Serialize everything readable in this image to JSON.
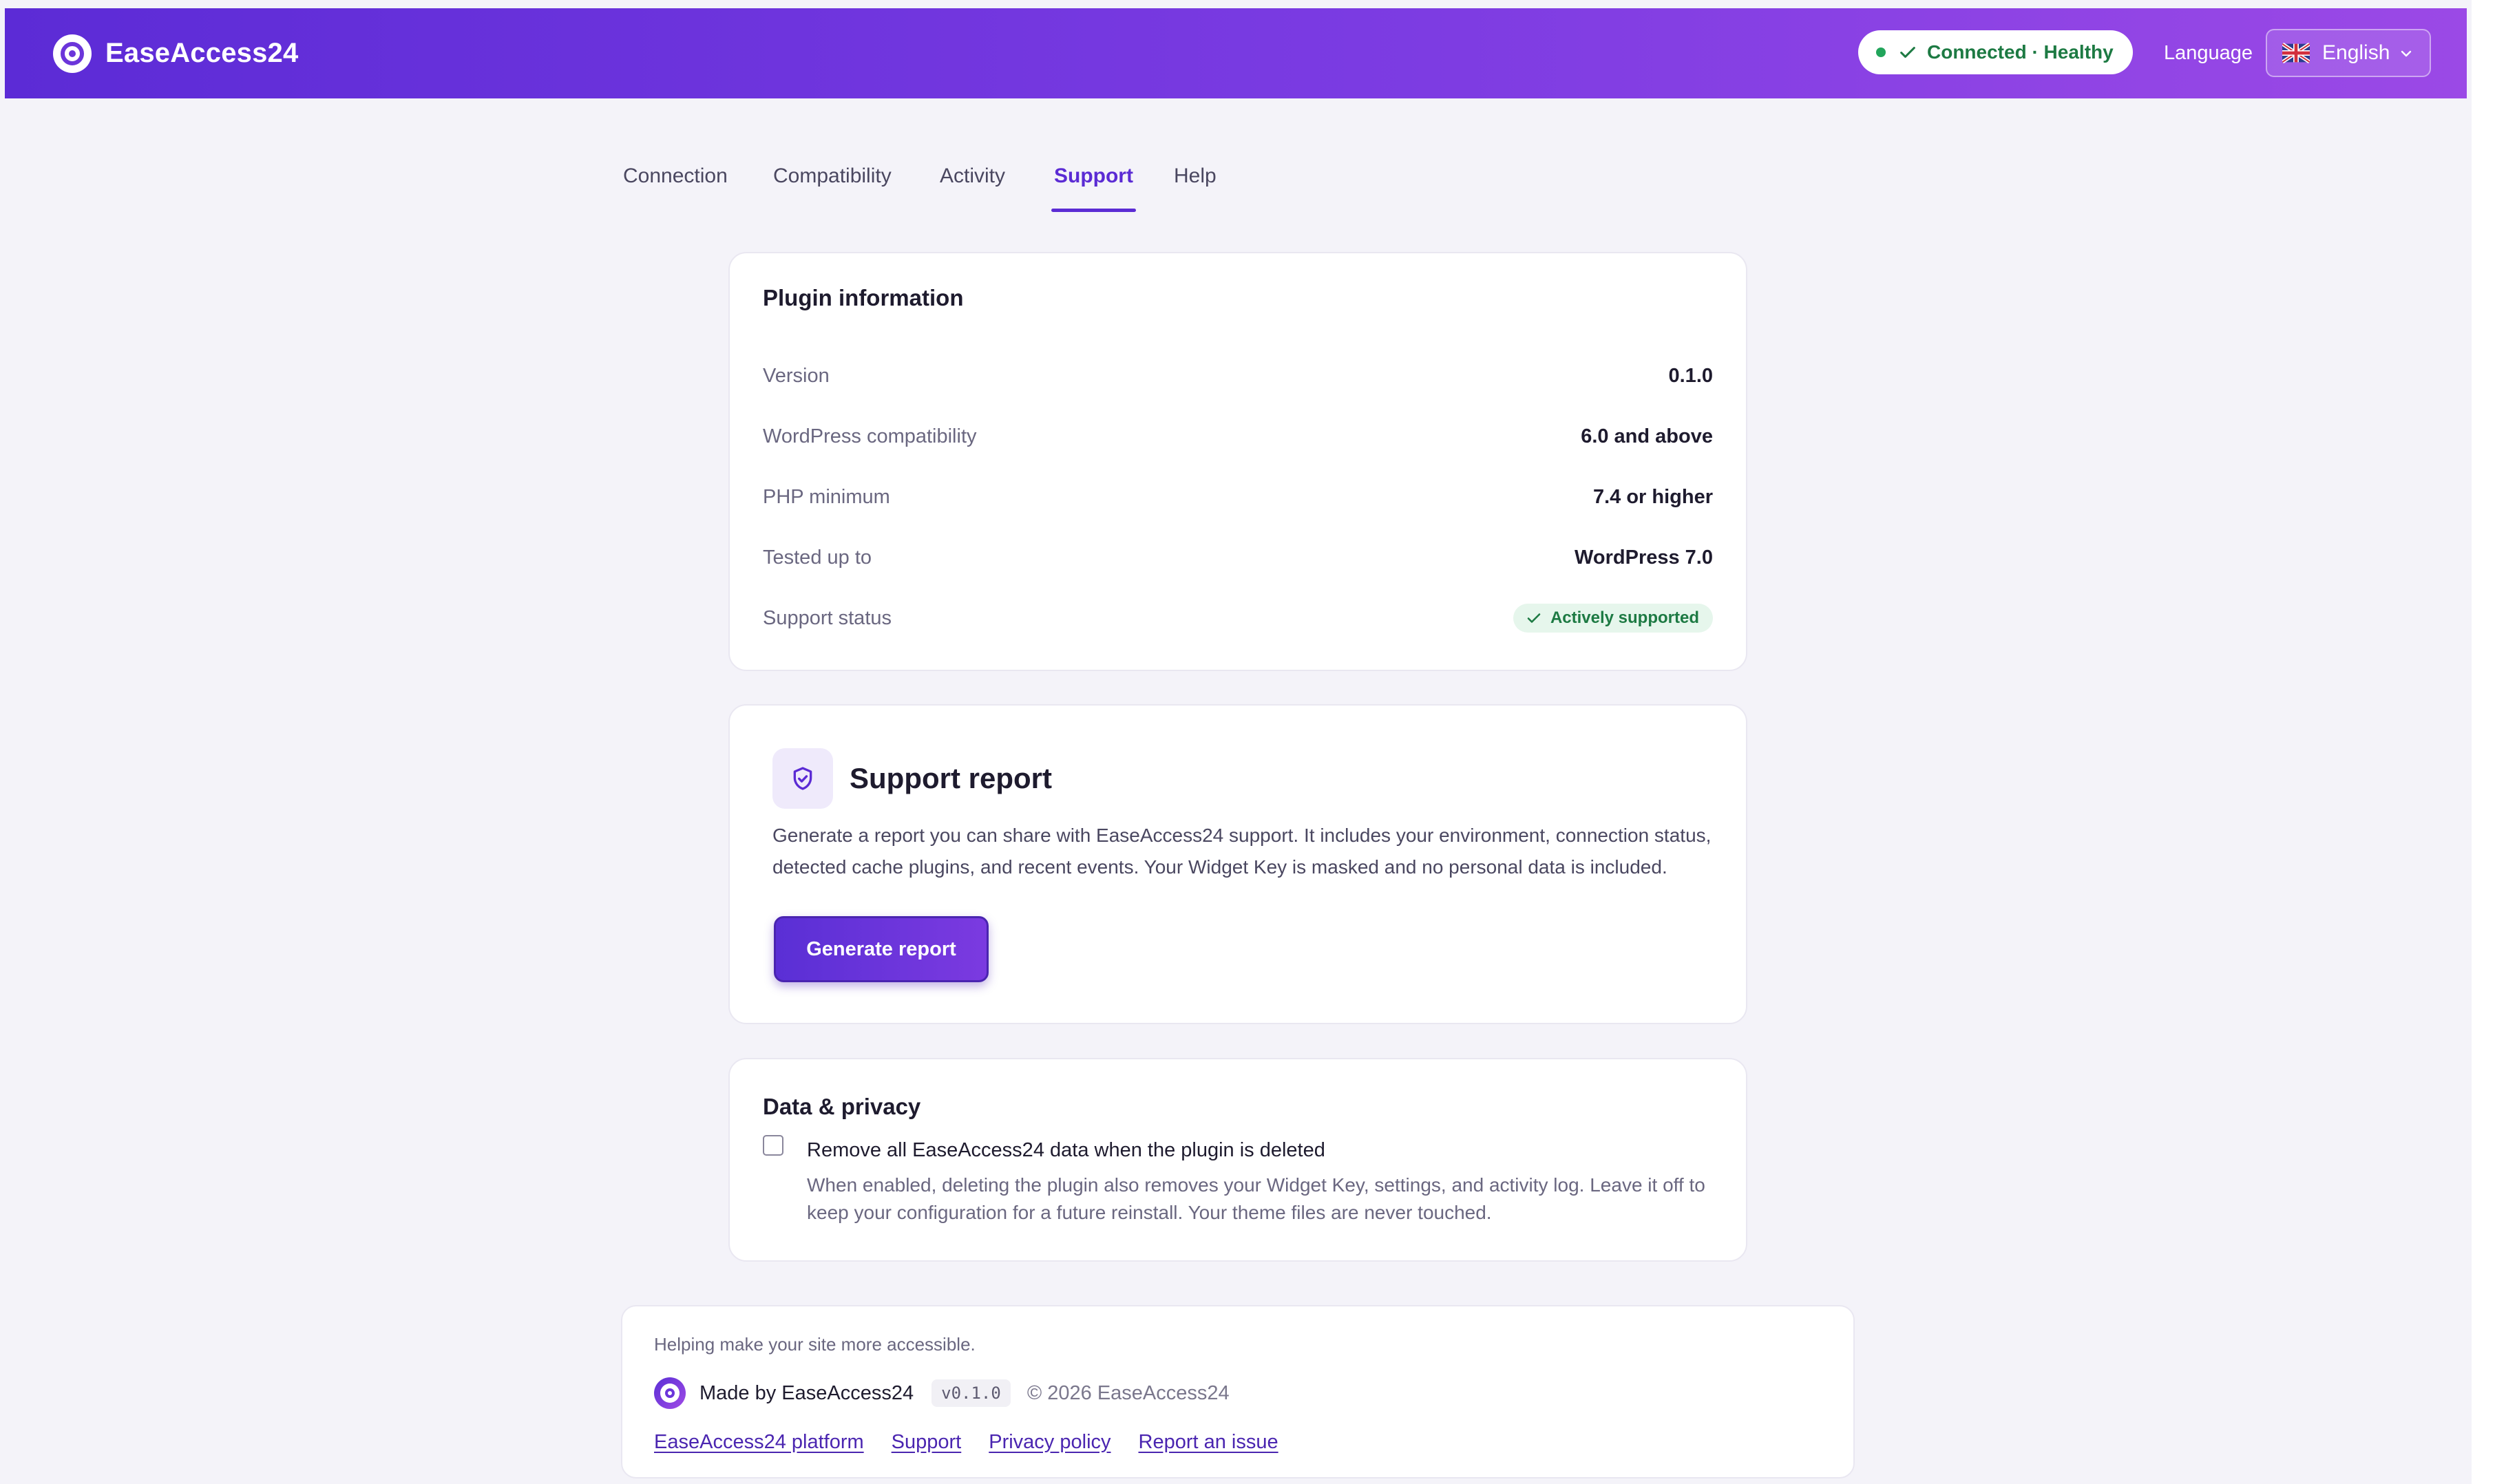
{
  "header": {
    "app_name": "EaseAccess24",
    "status": "Connected · Healthy",
    "language_label": "Language",
    "language_value": "English"
  },
  "tabs": [
    {
      "label": "Connection",
      "active": false
    },
    {
      "label": "Compatibility",
      "active": false
    },
    {
      "label": "Activity",
      "active": false
    },
    {
      "label": "Support",
      "active": true
    },
    {
      "label": "Help",
      "active": false
    }
  ],
  "plugin_info": {
    "title": "Plugin information",
    "rows": [
      {
        "label": "Version",
        "value": "0.1.0"
      },
      {
        "label": "WordPress compatibility",
        "value": "6.0 and above"
      },
      {
        "label": "PHP minimum",
        "value": "7.4 or higher"
      },
      {
        "label": "Tested up to",
        "value": "WordPress 7.0"
      },
      {
        "label": "Support status",
        "value": "Actively supported"
      }
    ]
  },
  "support_report": {
    "title": "Support report",
    "description": "Generate a report you can share with EaseAccess24 support. It includes your environment, connection status, detected cache plugins, and recent events. Your Widget Key is masked and no personal data is included.",
    "button_label": "Generate report"
  },
  "data_privacy": {
    "title": "Data & privacy",
    "checkbox_label": "Remove all EaseAccess24 data when the plugin is deleted",
    "checkbox_checked": false,
    "help_text": "When enabled, deleting the plugin also removes your Widget Key, settings, and activity log. Leave it off to keep your configuration for a future reinstall. Your theme files are never touched."
  },
  "footer": {
    "tagline": "Helping make your site more accessible.",
    "made_by": "Made by EaseAccess24",
    "version_chip": "v0.1.0",
    "copyright": "© 2026 EaseAccess24",
    "links": [
      "EaseAccess24 platform",
      "Support",
      "Privacy policy",
      "Report an issue"
    ]
  },
  "colors": {
    "brand_gradient_start": "#5c2bd6",
    "brand_gradient_end": "#9b49e6",
    "accent": "#5b2bd4",
    "success": "#1d7a43",
    "page_background": "#f4f3f9"
  },
  "icons": [
    "brand-logo-icon",
    "check-icon",
    "chevron-down-icon",
    "uk-flag-icon",
    "shield-check-icon"
  ]
}
